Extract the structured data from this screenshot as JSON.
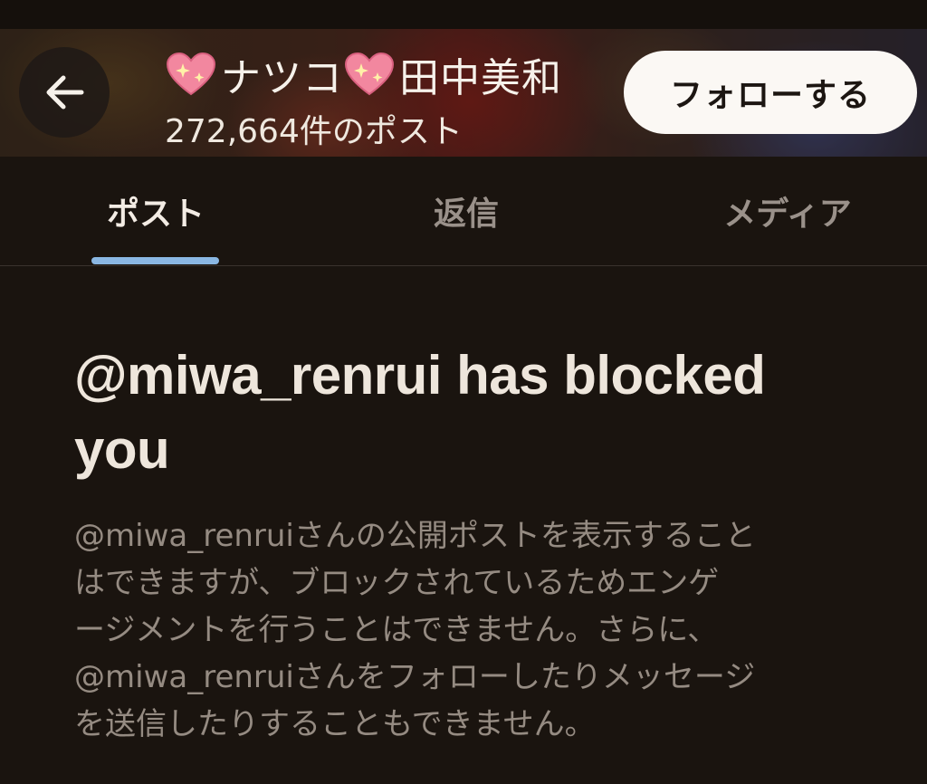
{
  "header": {
    "back_icon": "arrow-left-icon",
    "name_part1": "ナツコ",
    "name_part2": "田中美和",
    "heart_icon": "sparkling-heart-icon",
    "post_count": "272,664件のポスト",
    "follow_label": "フォローする"
  },
  "tabs": [
    {
      "label": "ポスト",
      "active": true
    },
    {
      "label": "返信",
      "active": false
    },
    {
      "label": "メディア",
      "active": false
    }
  ],
  "colors": {
    "active_tab_indicator": "#8ab7e3",
    "background": "#1a140f",
    "follow_button": "#fbf8f4"
  },
  "blocked": {
    "title": "@miwa_renrui has blocked you",
    "description_lines": [
      "@miwa_renruiさんの公開ポストを表示すること",
      "はできますが、ブロックされているためエンゲ",
      "ージメントを行うことはできません。さらに、",
      "@miwa_renruiさんをフォローしたりメッセージ",
      "を送信したりすることもできません。"
    ]
  }
}
